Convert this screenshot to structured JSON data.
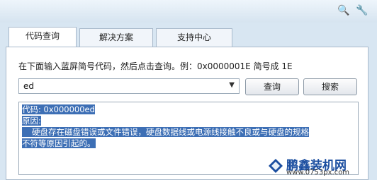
{
  "tabs": [
    {
      "label": "代码查询"
    },
    {
      "label": "解决方案"
    },
    {
      "label": "支持中心"
    }
  ],
  "titlebar": {
    "icons": [
      "search-icon",
      "wrench-icon"
    ]
  },
  "query": {
    "instruction": "在下面输入蓝屏简号代码，然后点击查询。例：0x0000001E 简号成 1E",
    "input_value": "ed",
    "query_button": "查询",
    "search_button": "搜索"
  },
  "result": {
    "line1": "代码: 0x000000ed",
    "line2": "原因:",
    "line3": "硬盘存在磁盘错误或文件错误，硬盘数据线或电源线接触不良或与硬盘的规格",
    "line4": "不符等原因引起的。"
  },
  "watermark": {
    "brand": "鹏鑫装机网",
    "url": "www.0753px.com",
    "accent": "#1b4ea0"
  }
}
